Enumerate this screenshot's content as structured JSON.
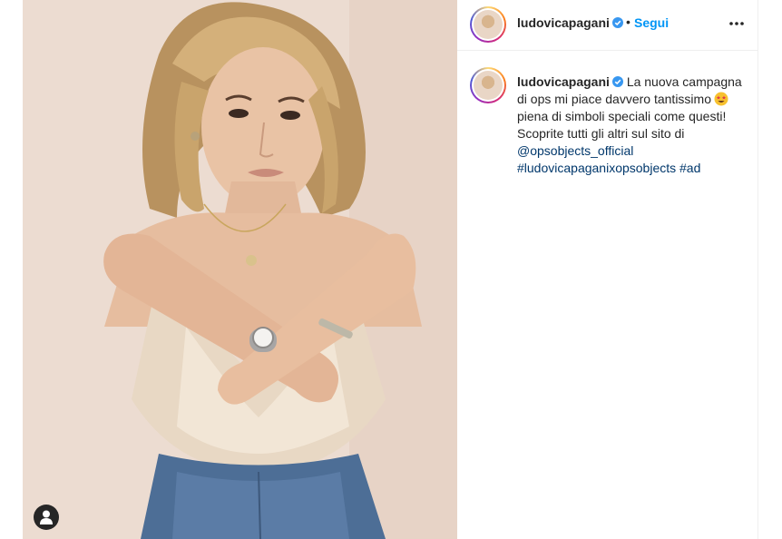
{
  "post": {
    "username": "ludovicapagani",
    "verified_icon": "verified-badge-icon",
    "separator": "•",
    "follow_label": "Segui",
    "more_icon": "more-options-icon"
  },
  "caption": {
    "username": "ludovicapagani",
    "text_1": "La nuova campagna di ops mi piace davvero tantissimo",
    "emoji_icon": "star-struck-emoji-icon",
    "text_2": "piena di simboli speciali come questi! Scoprite tutti gli altri sul sito di",
    "mention": "@opsobjects_official",
    "hashtag_1": "#ludovicapaganixopsobjects",
    "hashtag_2": "#ad"
  },
  "photo": {
    "user_tag_icon": "user-tag-icon"
  },
  "colors": {
    "accent": "#0095f6",
    "link": "#00376b",
    "text": "#262626",
    "border": "#efefef"
  }
}
